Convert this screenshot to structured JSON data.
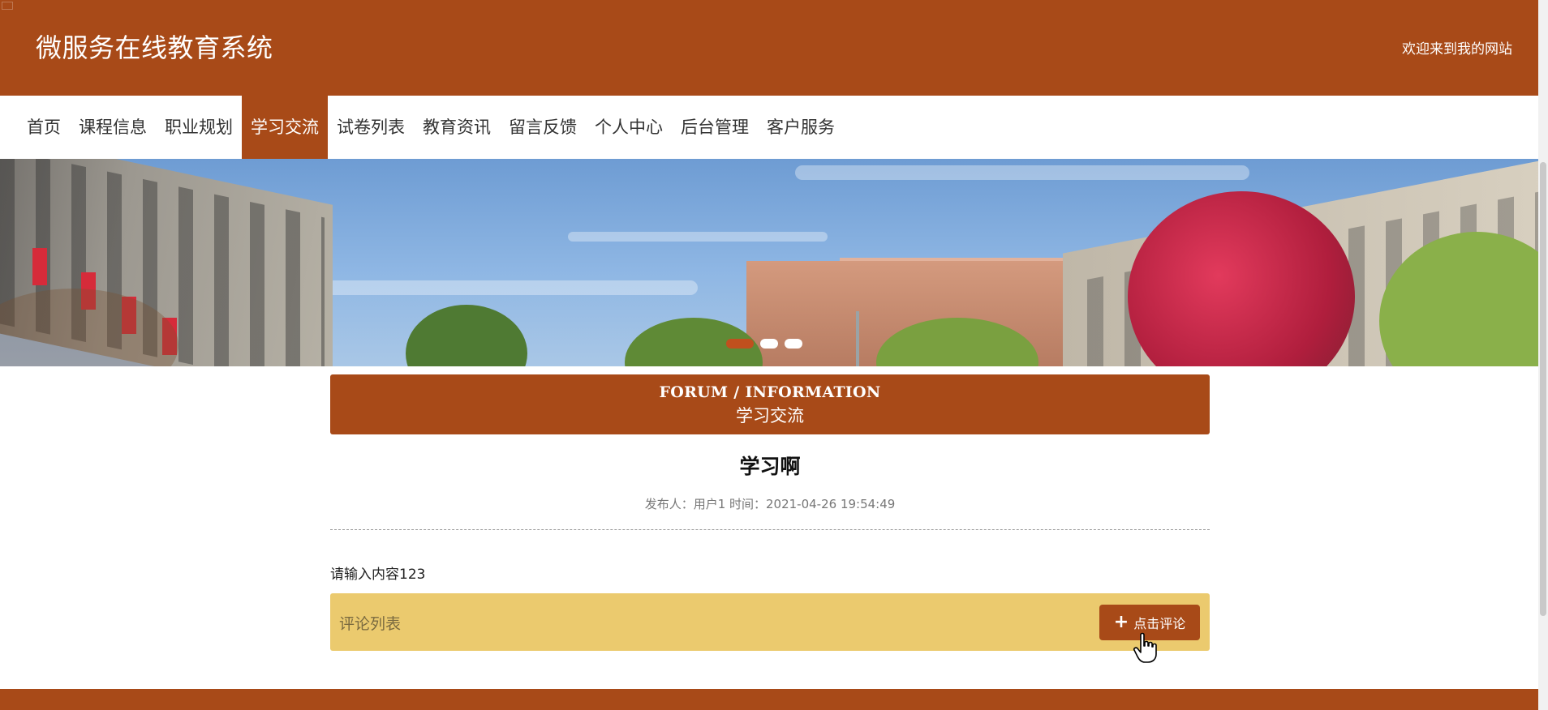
{
  "header": {
    "site_title": "微服务在线教育系统",
    "welcome_text": "欢迎来到我的网站"
  },
  "nav": {
    "items": [
      {
        "label": "首页"
      },
      {
        "label": "课程信息"
      },
      {
        "label": "职业规划"
      },
      {
        "label": "学习交流",
        "active": true
      },
      {
        "label": "试卷列表"
      },
      {
        "label": "教育资讯"
      },
      {
        "label": "留言反馈"
      },
      {
        "label": "个人中心"
      },
      {
        "label": "后台管理"
      },
      {
        "label": "客户服务"
      }
    ]
  },
  "banner": {
    "slide_count": 3,
    "active_slide": 1
  },
  "section": {
    "title_en": "FORUM / INFORMATION",
    "title_cn": "学习交流"
  },
  "post": {
    "title": "学习啊",
    "meta": "发布人：用户1 时间：2021-04-26 19:54:49",
    "content": "请输入内容123"
  },
  "comments": {
    "label": "评论列表",
    "button_label": "点击评论",
    "button_icon": "plus-icon"
  },
  "colors": {
    "brand": "#a84a18",
    "comment_bar": "#ebca6e"
  }
}
